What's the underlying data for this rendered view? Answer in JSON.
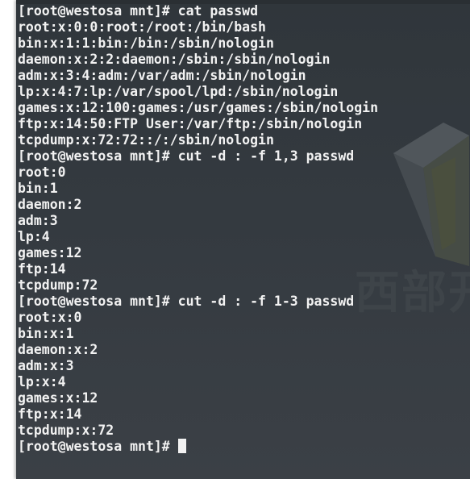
{
  "terminal": {
    "watermark": "西部开",
    "prompt": "[root@westosa mnt]# ",
    "lines": [
      "[root@westosa mnt]# cat passwd",
      "root:x:0:0:root:/root:/bin/bash",
      "bin:x:1:1:bin:/bin:/sbin/nologin",
      "daemon:x:2:2:daemon:/sbin:/sbin/nologin",
      "adm:x:3:4:adm:/var/adm:/sbin/nologin",
      "lp:x:4:7:lp:/var/spool/lpd:/sbin/nologin",
      "games:x:12:100:games:/usr/games:/sbin/nologin",
      "ftp:x:14:50:FTP User:/var/ftp:/sbin/nologin",
      "tcpdump:x:72:72::/:/sbin/nologin",
      "[root@westosa mnt]# cut -d : -f 1,3 passwd",
      "root:0",
      "bin:1",
      "daemon:2",
      "adm:3",
      "lp:4",
      "games:12",
      "ftp:14",
      "tcpdump:72",
      "[root@westosa mnt]# cut -d : -f 1-3 passwd",
      "root:x:0",
      "bin:x:1",
      "daemon:x:2",
      "adm:x:3",
      "lp:x:4",
      "games:x:12",
      "ftp:x:14",
      "tcpdump:x:72"
    ]
  },
  "colors": {
    "background": "#343a40",
    "foreground": "#f2f2f2"
  }
}
